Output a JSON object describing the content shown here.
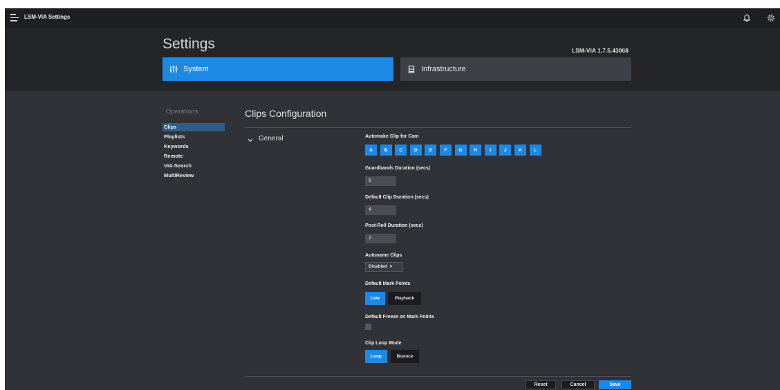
{
  "app": {
    "title": "LSM-VIA Settings"
  },
  "header": {
    "title": "Settings",
    "version": "LSM-VIA 1.7.5.43068"
  },
  "tabs": [
    {
      "label": "System",
      "icon": "sliders-icon",
      "active": true
    },
    {
      "label": "Infrastructure",
      "icon": "server-icon",
      "active": false
    }
  ],
  "sidebar": {
    "heading": "Operations",
    "items": [
      {
        "label": "Clips",
        "active": true
      },
      {
        "label": "Playlists"
      },
      {
        "label": "Keywords"
      },
      {
        "label": "Remote"
      },
      {
        "label": "VIA-Search"
      },
      {
        "label": "MultiReview"
      }
    ]
  },
  "main": {
    "title": "Clips Configuration",
    "group": "General",
    "automake": {
      "label": "Automake Clip for Cam",
      "cams": [
        "A",
        "B",
        "C",
        "D",
        "E",
        "F",
        "G",
        "H",
        "I",
        "J",
        "K",
        "L"
      ]
    },
    "guardbands": {
      "label": "Guardbands Duration (secs)",
      "value": "5"
    },
    "default_clip": {
      "label": "Default Clip Duration (secs)",
      "value": "4"
    },
    "post_roll": {
      "label": "Post-Roll Duration (secs)",
      "value": "2"
    },
    "autoname": {
      "label": "Autoname Clips",
      "value": "Disabled"
    },
    "mark_points": {
      "label": "Default Mark Points",
      "options": [
        "Live",
        "Playback"
      ],
      "selected": "Live"
    },
    "freeze": {
      "label": "Default Freeze on Mark Points",
      "checked": false
    },
    "loop_mode": {
      "label": "Clip Loop Mode",
      "options": [
        "Loop",
        "Bounce"
      ],
      "selected": "Loop"
    }
  },
  "footer": {
    "reset": "Reset",
    "cancel": "Cancel",
    "save": "Save"
  },
  "colors": {
    "accent": "#1e88e5",
    "background": "#303238",
    "header": "#242528",
    "topbar": "#1e1f22"
  }
}
